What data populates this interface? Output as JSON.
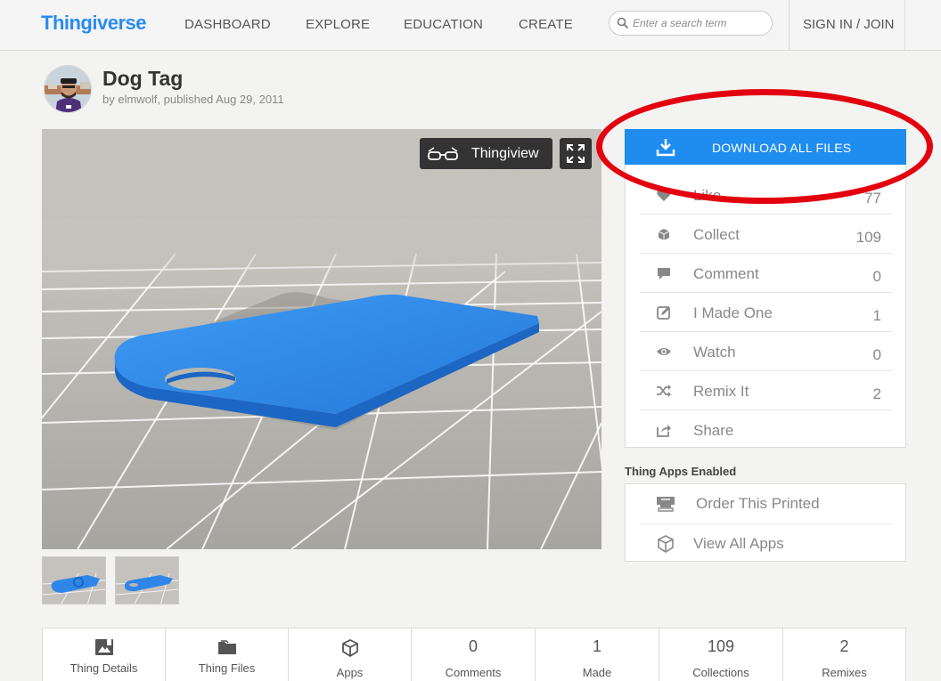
{
  "header": {
    "logo": "Thingiverse",
    "nav": [
      "DASHBOARD",
      "EXPLORE",
      "EDUCATION",
      "CREATE"
    ],
    "search_placeholder": "Enter a search term",
    "signin": "SIGN IN / JOIN"
  },
  "thing": {
    "title": "Dog Tag",
    "byline": "by elmwolf, published Aug 29, 2011"
  },
  "viewer": {
    "thingiview_label": "Thingiview",
    "model_color": "#2f86e8",
    "floor_color": "#a9a8a2"
  },
  "download": {
    "label": "DOWNLOAD ALL FILES",
    "color": "#1f8cf0"
  },
  "annotation_color": "#e3000f",
  "actions": [
    {
      "label": "Like",
      "count": "77",
      "icon": "heart-icon"
    },
    {
      "label": "Collect",
      "count": "109",
      "icon": "collect-icon"
    },
    {
      "label": "Comment",
      "count": "0",
      "icon": "comment-icon"
    },
    {
      "label": "I Made One",
      "count": "1",
      "icon": "made-one-icon"
    },
    {
      "label": "Watch",
      "count": "0",
      "icon": "eye-icon"
    },
    {
      "label": "Remix It",
      "count": "2",
      "icon": "shuffle-icon"
    },
    {
      "label": "Share",
      "count": "",
      "icon": "share-icon"
    }
  ],
  "apps": {
    "heading": "Thing Apps Enabled",
    "items": [
      {
        "label": "Order This Printed",
        "icon": "printer-icon"
      },
      {
        "label": "View All Apps",
        "icon": "cube-icon"
      }
    ]
  },
  "tabs": [
    {
      "label": "Thing Details",
      "number": "",
      "icon": "thing-details-icon"
    },
    {
      "label": "Thing Files",
      "number": "",
      "icon": "folder-icon"
    },
    {
      "label": "Apps",
      "number": "",
      "icon": "cube-icon"
    },
    {
      "label": "Comments",
      "number": "0"
    },
    {
      "label": "Made",
      "number": "1"
    },
    {
      "label": "Collections",
      "number": "109"
    },
    {
      "label": "Remixes",
      "number": "2"
    }
  ]
}
